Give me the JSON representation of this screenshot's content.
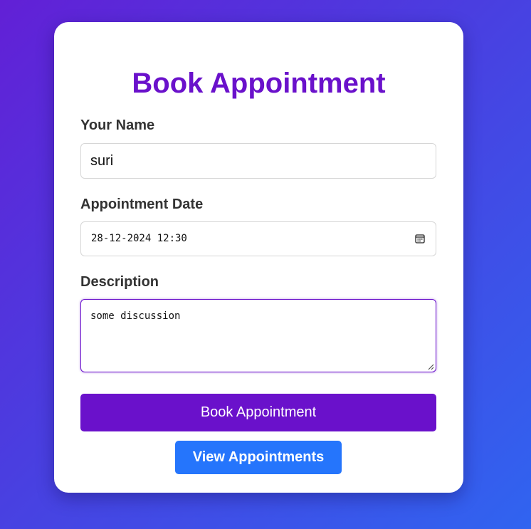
{
  "form": {
    "title": "Book Appointment",
    "name_label": "Your Name",
    "name_value": "suri",
    "date_label": "Appointment Date",
    "date_value": "28-12-2024 12:30",
    "description_label": "Description",
    "description_value": "some discussion",
    "submit_label": "Book Appointment",
    "view_label": "View Appointments"
  },
  "icons": {
    "calendar": "calendar-icon",
    "resize": "resize-handle-icon"
  },
  "colors": {
    "primary": "#6a11cb",
    "secondary": "#2575fc",
    "label": "#333333"
  }
}
